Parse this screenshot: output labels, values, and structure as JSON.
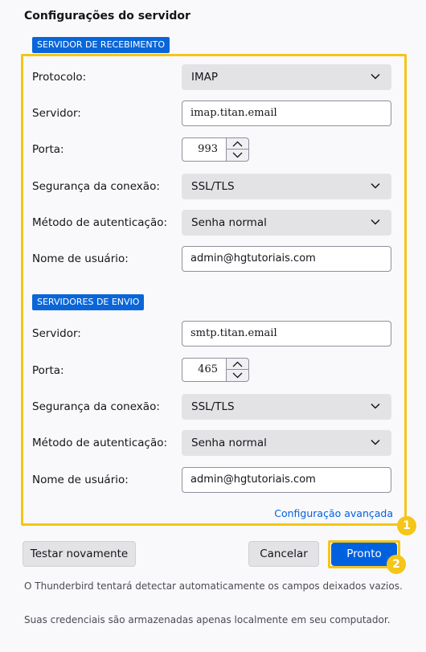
{
  "title": "Configurações do servidor",
  "incoming": {
    "section_label": "SERVIDOR DE RECEBIMENTO",
    "protocol_label": "Protocolo:",
    "protocol_value": "IMAP",
    "server_label": "Servidor:",
    "server_value": "imap.titan.email",
    "port_label": "Porta:",
    "port_value": "993",
    "security_label": "Segurança da conexão:",
    "security_value": "SSL/TLS",
    "auth_label": "Método de autenticação:",
    "auth_value": "Senha normal",
    "username_label": "Nome de usuário:",
    "username_value": "admin@hgtutoriais.com"
  },
  "outgoing": {
    "section_label": "SERVIDORES DE ENVIO",
    "server_label": "Servidor:",
    "server_value": "smtp.titan.email",
    "port_label": "Porta:",
    "port_value": "465",
    "security_label": "Segurança da conexão:",
    "security_value": "SSL/TLS",
    "auth_label": "Método de autenticação:",
    "auth_value": "Senha normal",
    "username_label": "Nome de usuário:",
    "username_value": "admin@hgtutoriais.com"
  },
  "advanced_link": "Configuração avançada",
  "annotations": {
    "badge1": "1",
    "badge2": "2"
  },
  "buttons": {
    "retest": "Testar novamente",
    "cancel": "Cancelar",
    "done": "Pronto"
  },
  "notes": {
    "autodetect": "O Thunderbird tentará detectar automaticamente os campos deixados vazios.",
    "credentials": "Suas credenciais são armazenadas apenas localmente em seu computador."
  },
  "colors": {
    "accent": "#0061e0",
    "badge": "#0a66d8",
    "highlight": "#f5c518"
  }
}
